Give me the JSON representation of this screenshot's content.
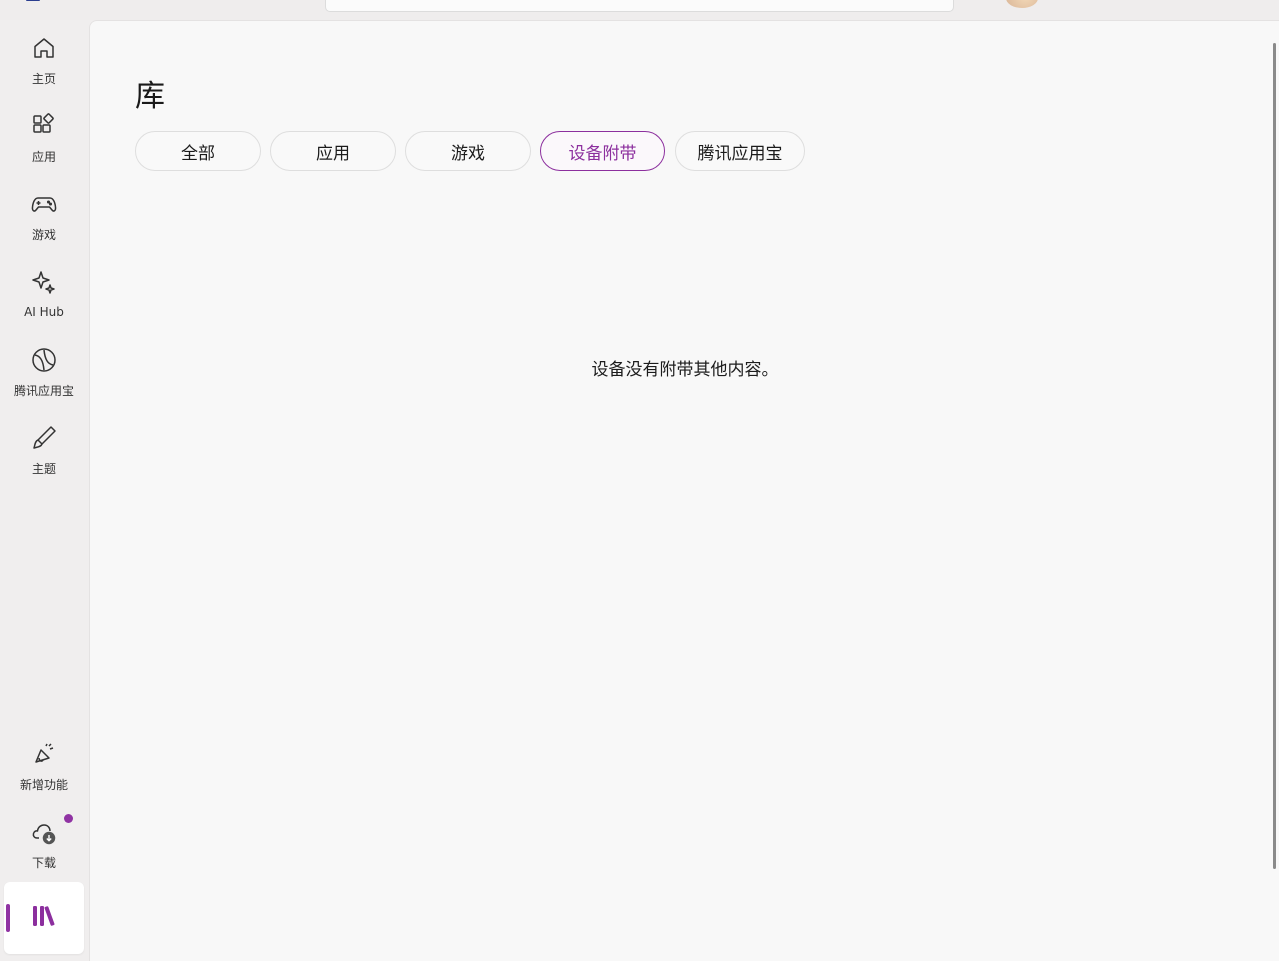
{
  "window": {
    "search_placeholder": ""
  },
  "sidebar": {
    "items": [
      {
        "label": "主页",
        "icon": "home-icon"
      },
      {
        "label": "应用",
        "icon": "apps-icon"
      },
      {
        "label": "游戏",
        "icon": "gamepad-icon"
      },
      {
        "label": "AI Hub",
        "icon": "sparkle-icon"
      },
      {
        "label": "腾讯应用宝",
        "icon": "tencent-appstore-icon"
      },
      {
        "label": "主题",
        "icon": "brush-icon"
      }
    ],
    "bottom_items": [
      {
        "label": "新增功能",
        "icon": "megaphone-icon"
      },
      {
        "label": "下载",
        "icon": "cloud-download-icon",
        "has_badge": true
      },
      {
        "label": "库",
        "icon": "library-icon",
        "active": true
      }
    ],
    "accent_color": "#9033a3"
  },
  "main": {
    "title": "库",
    "filters": [
      {
        "label": "全部",
        "selected": false
      },
      {
        "label": "应用",
        "selected": false
      },
      {
        "label": "游戏",
        "selected": false
      },
      {
        "label": "设备附带",
        "selected": true
      },
      {
        "label": "腾讯应用宝",
        "selected": false
      }
    ],
    "empty_message": "设备没有附带其他内容。"
  }
}
